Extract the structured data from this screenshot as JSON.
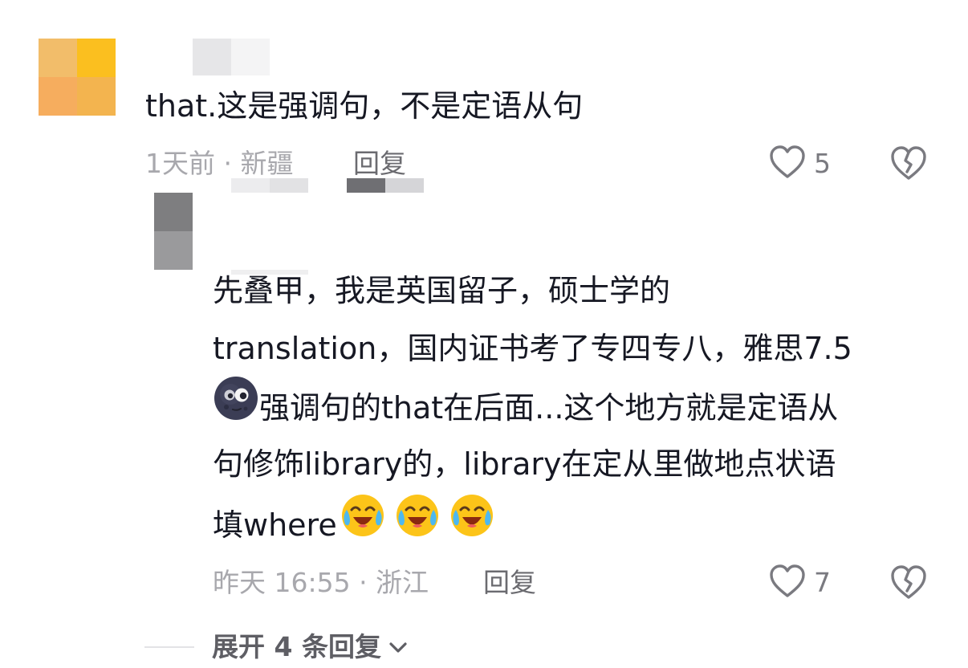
{
  "comment": {
    "text": "that.这是强调句，不是定语从句",
    "time_location": "1天前 · 新疆",
    "reply_label": "回复",
    "like_count": "5"
  },
  "reply": {
    "lines": [
      "先叠甲，我是英国留子，硕士学的",
      "translation，国内证书考了专四专八，雅思7.5",
      "强调句的that在后面...这个地方就是定语从",
      "句修饰library的，library在定从里做地点状语",
      "填where"
    ],
    "time_location": "昨天 16:55 · 浙江",
    "reply_label": "回复",
    "like_count": "7"
  },
  "expand": {
    "label": "展开 4 条回复"
  },
  "icons": {
    "like": "heart-outline-icon",
    "dislike": "broken-heart-icon",
    "expand": "chevron-down-icon",
    "emoji_moon": "new-moon-face-emoji",
    "emoji_laugh_cry": "laughing-crying-face-emoji"
  },
  "colors": {
    "text_primary": "#161823",
    "text_meta": "#a8a8ad",
    "icon_gray": "#7a7a80"
  }
}
